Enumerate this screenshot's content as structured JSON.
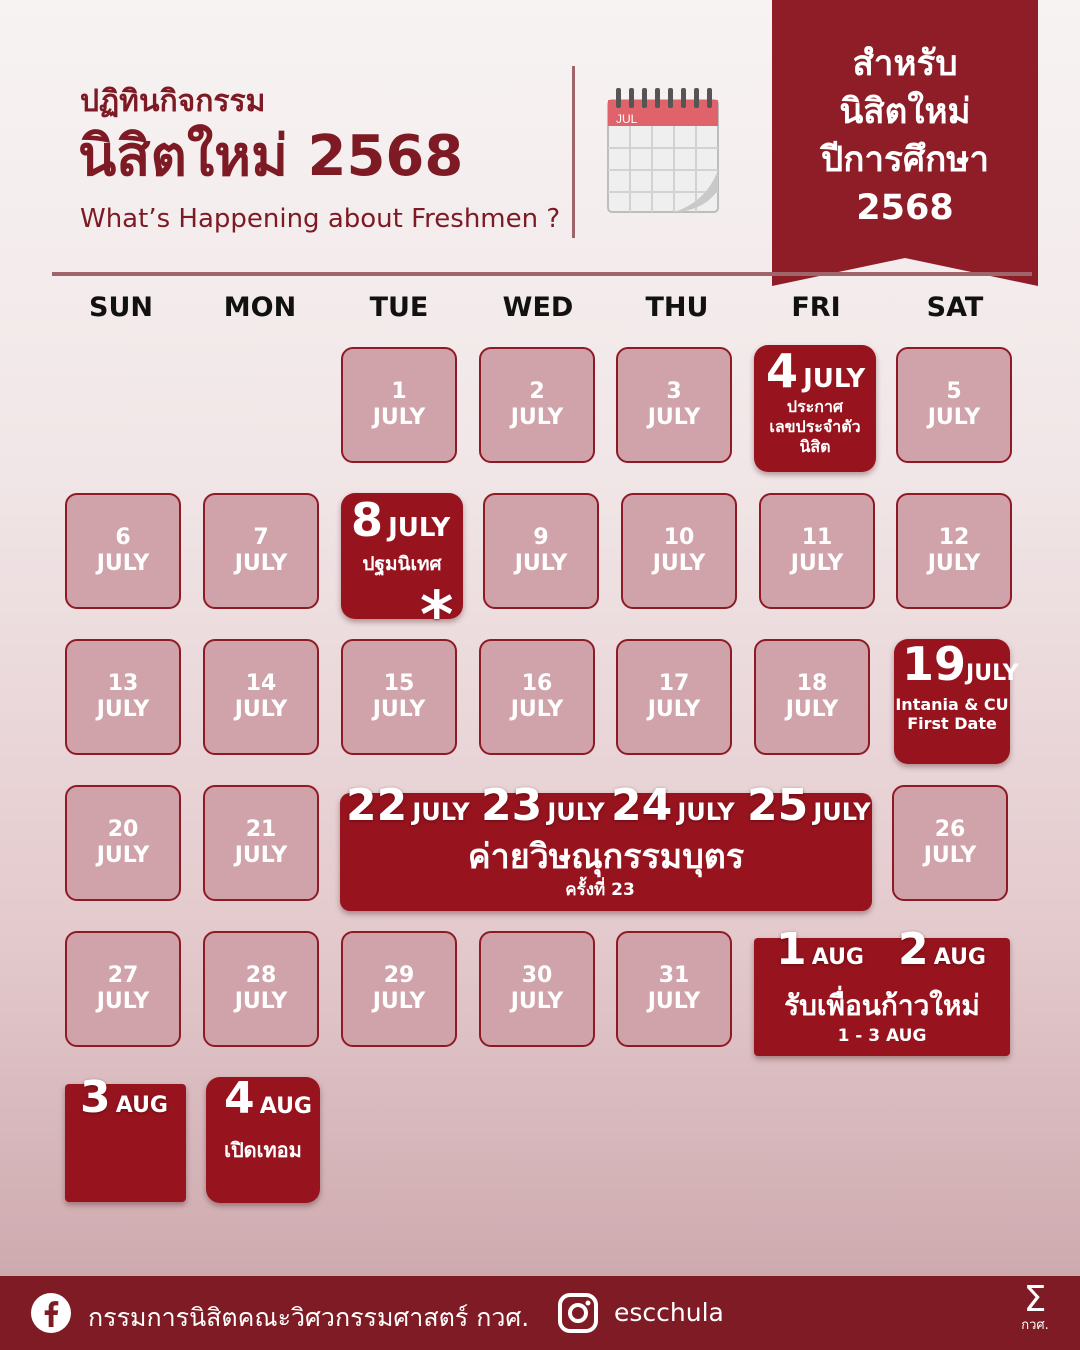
{
  "header": {
    "title_line1": "ปฏิทินกิจกรรม",
    "title_line2": "นิสิตใหม่ 2568",
    "subtitle": "What’s Happening about Freshmen ?",
    "calendar_icon_month": "JUL"
  },
  "banner": {
    "lines": [
      "สำหรับ",
      "นิสิตใหม่",
      "ปีการศึกษา",
      "2568"
    ]
  },
  "weekdays": [
    "SUN",
    "MON",
    "TUE",
    "WED",
    "THU",
    "FRI",
    "SAT"
  ],
  "days": [
    {
      "id": "d1",
      "day": "1",
      "month": "JULY"
    },
    {
      "id": "d2",
      "day": "2",
      "month": "JULY"
    },
    {
      "id": "d3",
      "day": "3",
      "month": "JULY"
    },
    {
      "id": "d5",
      "day": "5",
      "month": "JULY"
    },
    {
      "id": "d6",
      "day": "6",
      "month": "JULY"
    },
    {
      "id": "d7",
      "day": "7",
      "month": "JULY"
    },
    {
      "id": "d9",
      "day": "9",
      "month": "JULY"
    },
    {
      "id": "d10",
      "day": "10",
      "month": "JULY"
    },
    {
      "id": "d11",
      "day": "11",
      "month": "JULY"
    },
    {
      "id": "d12",
      "day": "12",
      "month": "JULY"
    },
    {
      "id": "d13",
      "day": "13",
      "month": "JULY"
    },
    {
      "id": "d14",
      "day": "14",
      "month": "JULY"
    },
    {
      "id": "d15",
      "day": "15",
      "month": "JULY"
    },
    {
      "id": "d16",
      "day": "16",
      "month": "JULY"
    },
    {
      "id": "d17",
      "day": "17",
      "month": "JULY"
    },
    {
      "id": "d18",
      "day": "18",
      "month": "JULY"
    },
    {
      "id": "d20",
      "day": "20",
      "month": "JULY"
    },
    {
      "id": "d21",
      "day": "21",
      "month": "JULY"
    },
    {
      "id": "d26",
      "day": "26",
      "month": "JULY"
    },
    {
      "id": "d27",
      "day": "27",
      "month": "JULY"
    },
    {
      "id": "d28",
      "day": "28",
      "month": "JULY"
    },
    {
      "id": "d29",
      "day": "29",
      "month": "JULY"
    },
    {
      "id": "d30",
      "day": "30",
      "month": "JULY"
    },
    {
      "id": "d31",
      "day": "31",
      "month": "JULY"
    }
  ],
  "events": {
    "e4": {
      "day": "4",
      "month": "JULY",
      "label_lines": [
        "ประกาศ",
        "เลขประจำตัว",
        "นิสิต"
      ]
    },
    "e8": {
      "day": "8",
      "month": "JULY",
      "label": "ปฐมนิเทศ",
      "mark": "*"
    },
    "e19": {
      "day": "19",
      "month": "JULY",
      "label_lines": [
        "Intania & CU",
        "First Date"
      ]
    },
    "camp": {
      "days": [
        "22",
        "23",
        "24",
        "25"
      ],
      "month": "JULY",
      "title": "ค่ายวิษณุกรรมบุตร",
      "subtitle": "ครั้งที่ 23"
    },
    "welcome": {
      "days": [
        "1",
        "2"
      ],
      "month": "AUG",
      "title": "รับเพื่อนก้าวใหม่",
      "subtitle": "1 - 3 AUG"
    },
    "e3aug": {
      "day": "3",
      "month": "AUG"
    },
    "e4aug": {
      "day": "4",
      "month": "AUG",
      "label": "เปิดเทอม"
    }
  },
  "footer": {
    "facebook_icon": "facebook-icon",
    "facebook_text": "กรรมการนิสิตคณะวิศวกรรมศาสตร์ กวศ.",
    "instagram_icon": "instagram-icon",
    "instagram_text": "escchula",
    "logo_symbol": "Σ",
    "logo_text": "กวศ."
  },
  "colors": {
    "primary": "#97141f",
    "dark": "#7e1b25",
    "cell": "#d0a2a9"
  }
}
